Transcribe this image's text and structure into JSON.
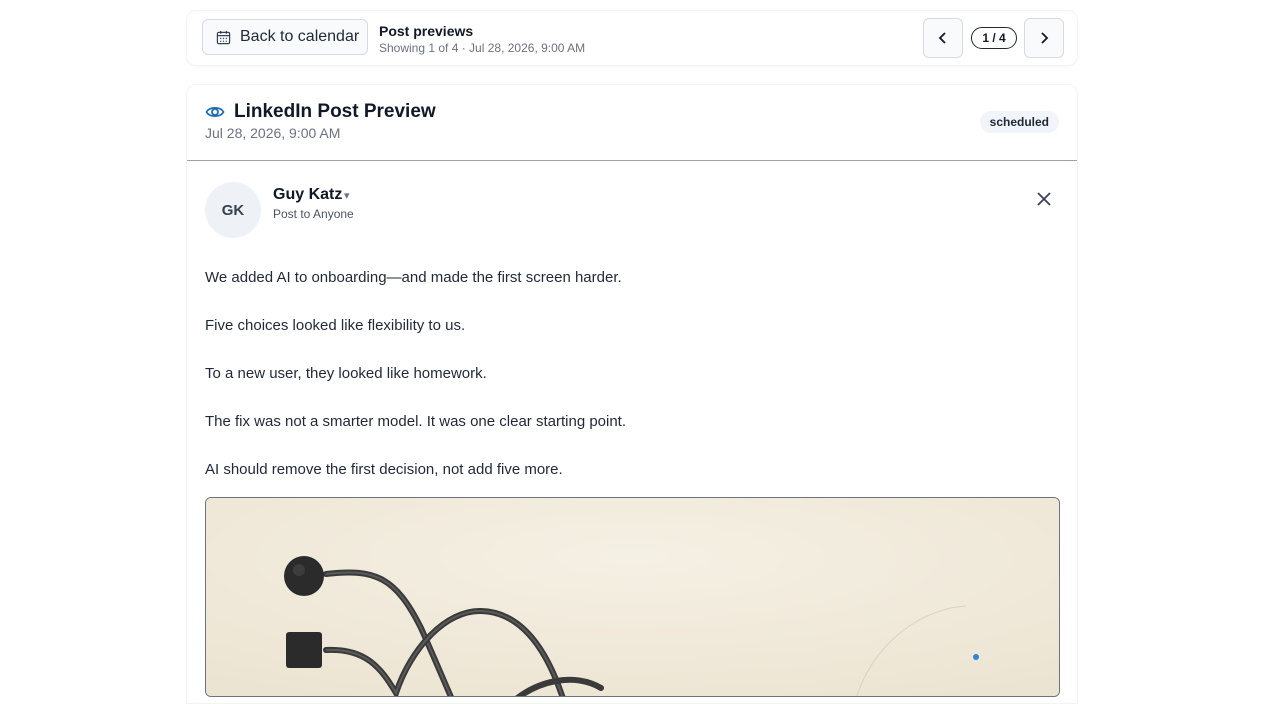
{
  "topbar": {
    "back_label": "Back to calendar",
    "title": "Post previews",
    "subtitle": "Showing 1 of 4 · Jul 28, 2026, 9:00 AM",
    "pager": "1 / 4",
    "icons": {
      "back": "calendar-icon",
      "prev": "chevron-left-icon",
      "next": "chevron-right-icon"
    }
  },
  "card": {
    "title": "LinkedIn Post Preview",
    "date": "Jul 28, 2026, 9:00 AM",
    "status": "scheduled",
    "title_icon": "eye-icon",
    "accent": "#1a6fb3"
  },
  "post": {
    "initials": "GK",
    "author": "Guy Katz",
    "caret": "▾",
    "audience": "Post to Anyone",
    "paragraphs": [
      "We added AI to onboarding—and made the first screen harder.",
      "Five choices looked like flexibility to us.",
      "To a new user, they looked like homework.",
      "The fix was not a smarter model. It was one clear starting point.",
      "AI should remove the first decision, not add five more."
    ]
  }
}
